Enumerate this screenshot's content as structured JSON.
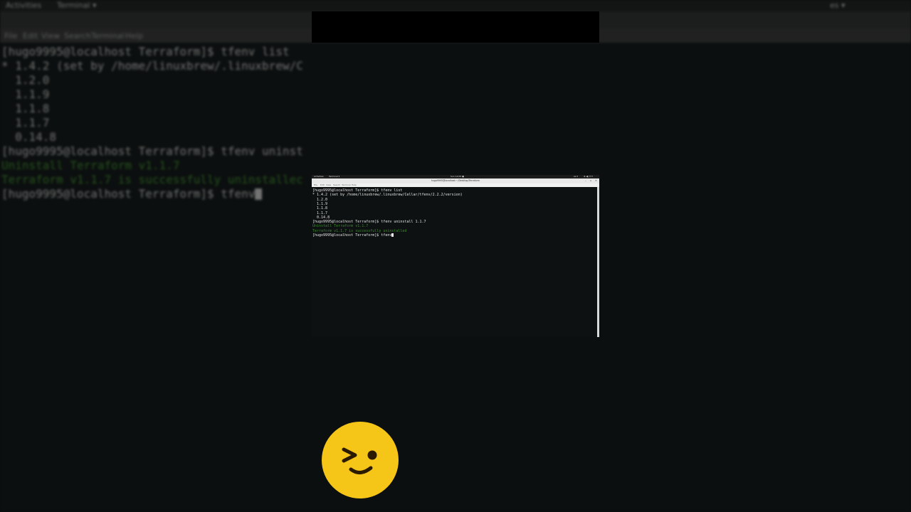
{
  "gnome_topbar": {
    "activities": "Activities",
    "app_menu": "Terminal ▾",
    "clock": "Sun 12:05 ●",
    "input_source": "es ▾",
    "system_status": "⊕ ◀) ⏻ ▾"
  },
  "window": {
    "title": "hugo9995@localhost:~/Desktop/Terraform",
    "controls": [
      "–",
      "▫",
      "✕"
    ]
  },
  "menubar": [
    "File",
    "Edit",
    "View",
    "Search",
    "Terminal",
    "Help"
  ],
  "terminal_lines": [
    {
      "text": "[hugo9995@localhost Terraform]$ tfenv list",
      "style": "normal"
    },
    {
      "text": "* 1.4.2 (set by /home/linuxbrew/.linuxbrew/Cellar/tfenv/2.2.2/version)",
      "style": "normal"
    },
    {
      "text": "  1.2.0",
      "style": "normal"
    },
    {
      "text": "  1.1.9",
      "style": "normal"
    },
    {
      "text": "  1.1.8",
      "style": "normal"
    },
    {
      "text": "  1.1.7",
      "style": "normal"
    },
    {
      "text": "  0.14.8",
      "style": "normal"
    },
    {
      "text": "[hugo9995@localhost Terraform]$ tfenv uninstall 1.1.7",
      "style": "normal"
    },
    {
      "text": "Uninstall Terraform v1.1.7",
      "style": "green"
    },
    {
      "text": "Terraform v1.1.7 is successfully uninstalled",
      "style": "green"
    },
    {
      "text": "[hugo9995@localhost Terraform]$ tfenv",
      "style": "normal"
    }
  ],
  "background_zoom": {
    "topbar_activities": "Activities",
    "topbar_app": "Terminal ▾",
    "topbar_right": "es ▾",
    "menubar": [
      "File",
      "Edit",
      "View",
      "Search",
      "Terminal",
      "Help"
    ],
    "lines": [
      {
        "text": "[hugo9995@localhost Terraform]$ tfenv list",
        "style": "normal"
      },
      {
        "text": "* 1.4.2 (set by /home/linuxbrew/.linuxbrew/C",
        "style": "normal"
      },
      {
        "text": "  1.2.0",
        "style": "normal"
      },
      {
        "text": "  1.1.9",
        "style": "normal"
      },
      {
        "text": "  1.1.8",
        "style": "normal"
      },
      {
        "text": "  1.1.7",
        "style": "normal"
      },
      {
        "text": "  0.14.8",
        "style": "normal"
      },
      {
        "text": "[hugo9995@localhost Terraform]$ tfenv uninst",
        "style": "normal"
      },
      {
        "text": "Uninstall Terraform v1.1.7",
        "style": "green"
      },
      {
        "text": "Terraform v1.1.7 is successfully uninstallec",
        "style": "green"
      },
      {
        "text": "[hugo9995@localhost Terraform]$ tfenv",
        "style": "normal"
      }
    ]
  },
  "emoji": {
    "name": "winking-face-emoji",
    "color": "#f5c518"
  },
  "colors": {
    "terminal_bg": "#0d1111",
    "prompt_text": "#e6e6e6",
    "success_green": "#3c8c2c"
  }
}
